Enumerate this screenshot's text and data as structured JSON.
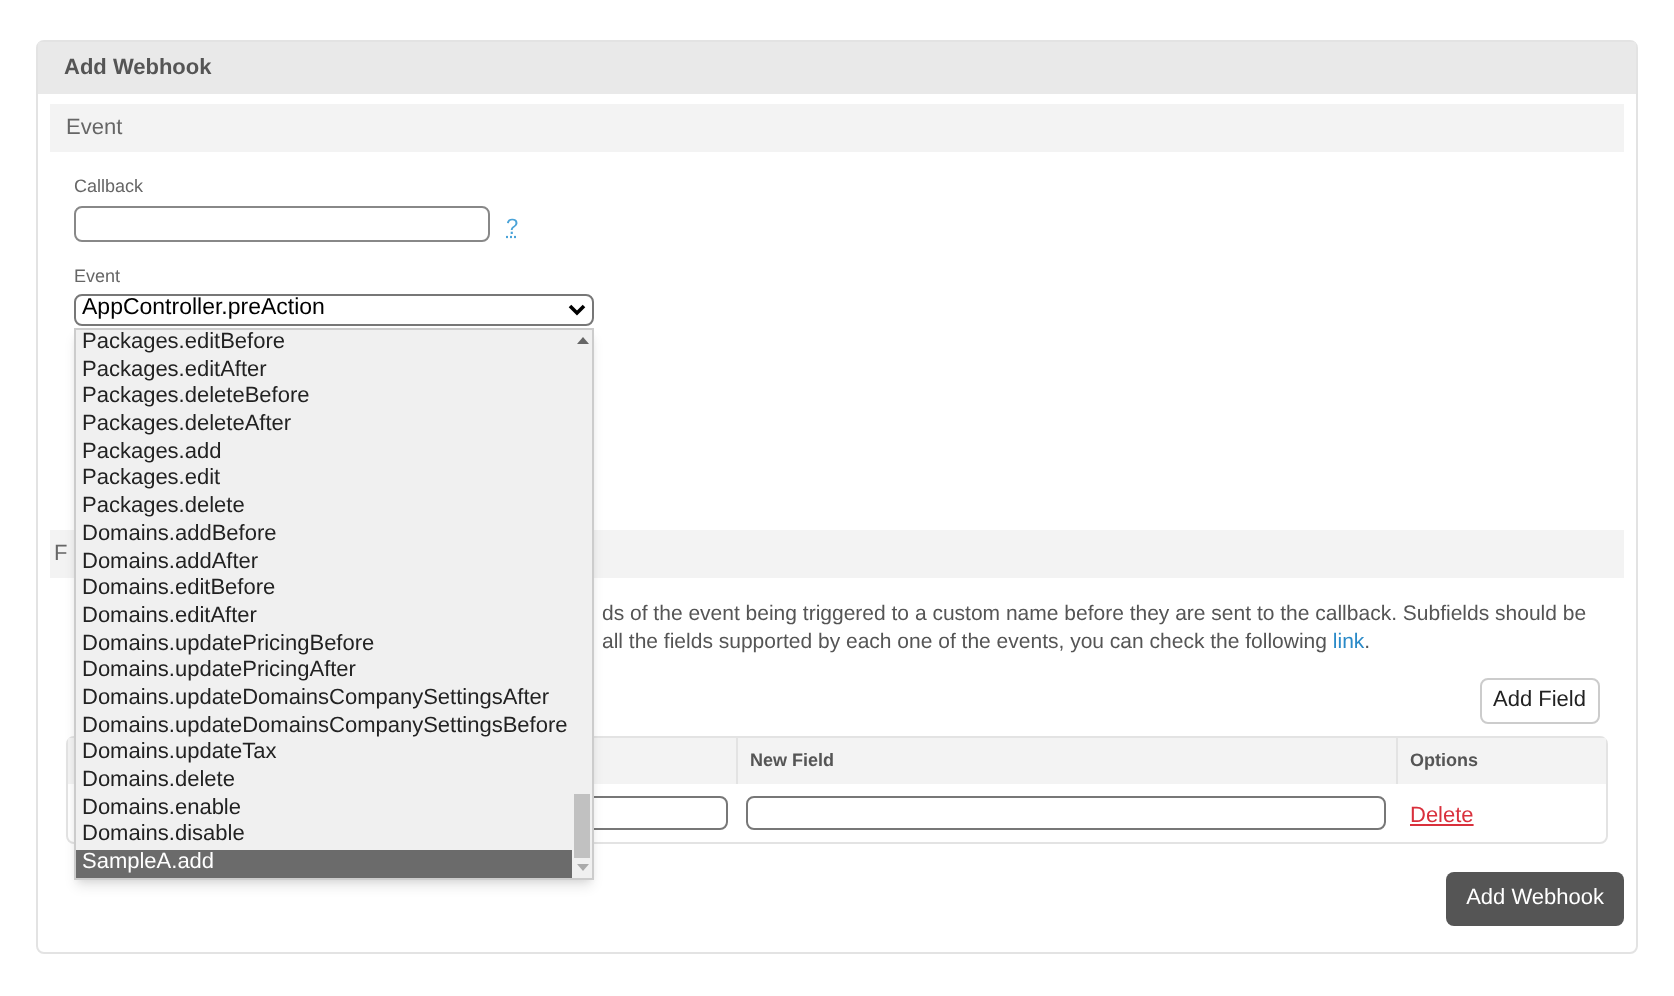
{
  "panel": {
    "title": "Add Webhook"
  },
  "event_section": {
    "title": "Event",
    "callback": {
      "label": "Callback",
      "help": "?"
    },
    "event": {
      "label": "Event",
      "value": "AppController.preAction",
      "open": true,
      "options": [
        {
          "label": "Packages.editBefore",
          "selected": false
        },
        {
          "label": "Packages.editAfter",
          "selected": false
        },
        {
          "label": "Packages.deleteBefore",
          "selected": false
        },
        {
          "label": "Packages.deleteAfter",
          "selected": false
        },
        {
          "label": "Packages.add",
          "selected": false
        },
        {
          "label": "Packages.edit",
          "selected": false
        },
        {
          "label": "Packages.delete",
          "selected": false
        },
        {
          "label": "Domains.addBefore",
          "selected": false
        },
        {
          "label": "Domains.addAfter",
          "selected": false
        },
        {
          "label": "Domains.editBefore",
          "selected": false
        },
        {
          "label": "Domains.editAfter",
          "selected": false
        },
        {
          "label": "Domains.updatePricingBefore",
          "selected": false
        },
        {
          "label": "Domains.updatePricingAfter",
          "selected": false
        },
        {
          "label": "Domains.updateDomainsCompanySettingsAfter",
          "selected": false
        },
        {
          "label": "Domains.updateDomainsCompanySettingsBefore",
          "selected": false
        },
        {
          "label": "Domains.updateTax",
          "selected": false
        },
        {
          "label": "Domains.delete",
          "selected": false
        },
        {
          "label": "Domains.enable",
          "selected": false
        },
        {
          "label": "Domains.disable",
          "selected": false
        },
        {
          "label": "SampleA.add",
          "selected": true
        }
      ]
    }
  },
  "fields_section": {
    "title": "F",
    "description_line_1": "ds of the event being triggered to a custom name before they are sent to the callback. Subfields should be",
    "description_line_2": "all the fields supported by each one of the events, you can check the following",
    "link": "link",
    "description_end": ".",
    "add_button": "Add Field",
    "table": {
      "columns": [
        "New Field",
        "Options"
      ],
      "rows": [
        {
          "action": "Delete"
        }
      ]
    }
  },
  "submit_button": "Add Webhook"
}
